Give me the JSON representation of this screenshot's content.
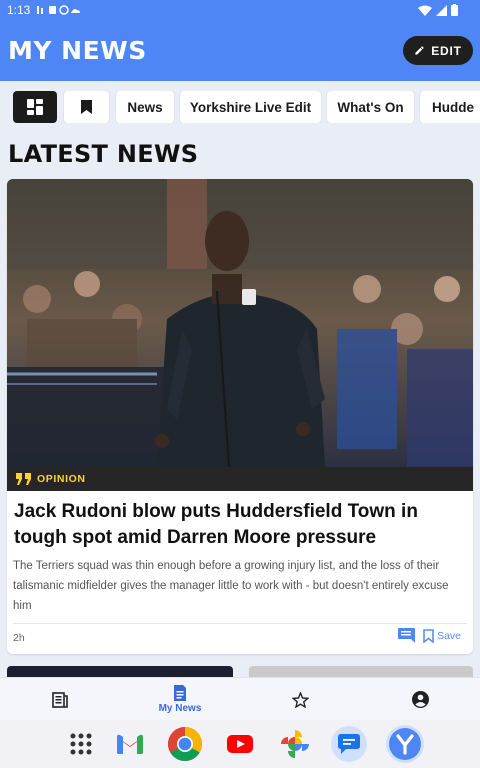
{
  "status_bar": {
    "time": "1:13"
  },
  "header": {
    "title": "MY NEWS",
    "edit_label": "EDIT"
  },
  "chips": {
    "grid_icon": "grid-icon",
    "bookmark_icon": "bookmark-icon",
    "items": [
      "News",
      "Yorkshire Live Edit",
      "What's On",
      "Hudde"
    ]
  },
  "section": {
    "title": "LATEST NEWS"
  },
  "article": {
    "tag": "OPINION",
    "headline": "Jack Rudoni blow puts Huddersfield Town in tough spot amid Darren Moore pressure",
    "summary": "The Terriers squad was thin enough before a growing injury list, and the loss of their talismanic midfielder gives the manager little to work with - but doesn't entirely excuse him",
    "time": "2h",
    "save_label": "Save"
  },
  "bottom_nav": {
    "items": [
      {
        "icon": "article-icon",
        "label": ""
      },
      {
        "icon": "my-news-icon",
        "label": "My News",
        "active": true
      },
      {
        "icon": "star-icon",
        "label": ""
      },
      {
        "icon": "account-icon",
        "label": ""
      }
    ]
  },
  "dock": {
    "apps": [
      "app-drawer-icon",
      "gmail-icon",
      "chrome-icon",
      "youtube-icon",
      "photos-icon",
      "messages-icon",
      "yorkshire-live-icon"
    ]
  },
  "colors": {
    "accent": "#4f86f5",
    "tag_yellow": "#ffd333",
    "link_blue": "#5b8ef7"
  }
}
